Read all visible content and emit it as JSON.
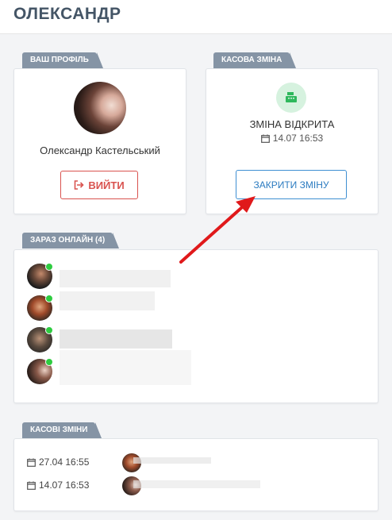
{
  "header": {
    "title": "ОЛЕКСАНДР"
  },
  "profile": {
    "section_label": "ВАШ ПРОФІЛЬ",
    "name": "Олександр Кастельський",
    "logout_label": "ВИЙТИ"
  },
  "shift": {
    "section_label": "КАСОВА ЗМІНА",
    "status": "ЗМІНА ВІДКРИТА",
    "opened_at": "14.07 16:53",
    "close_label": "ЗАКРИТИ ЗМІНУ"
  },
  "online": {
    "section_label": "ЗАРАЗ ОНЛАЙН (4)",
    "users": [
      {
        "name": ""
      },
      {
        "name": ""
      },
      {
        "name": ""
      },
      {
        "name": ""
      }
    ]
  },
  "sessions": {
    "section_label": "КАСОВІ ЗМІНИ",
    "items": [
      {
        "date": "27.04 16:55"
      },
      {
        "date": "14.07 16:53"
      }
    ]
  },
  "colors": {
    "tag_bg": "#8594a5",
    "danger": "#d9534f",
    "primary": "#2b7bc0",
    "online": "#2ecc40",
    "arrow": "#e0191b"
  },
  "icons": [
    "sign-out-icon",
    "cash-register-icon",
    "calendar-icon",
    "online-status-icon",
    "arrow-annotation"
  ]
}
